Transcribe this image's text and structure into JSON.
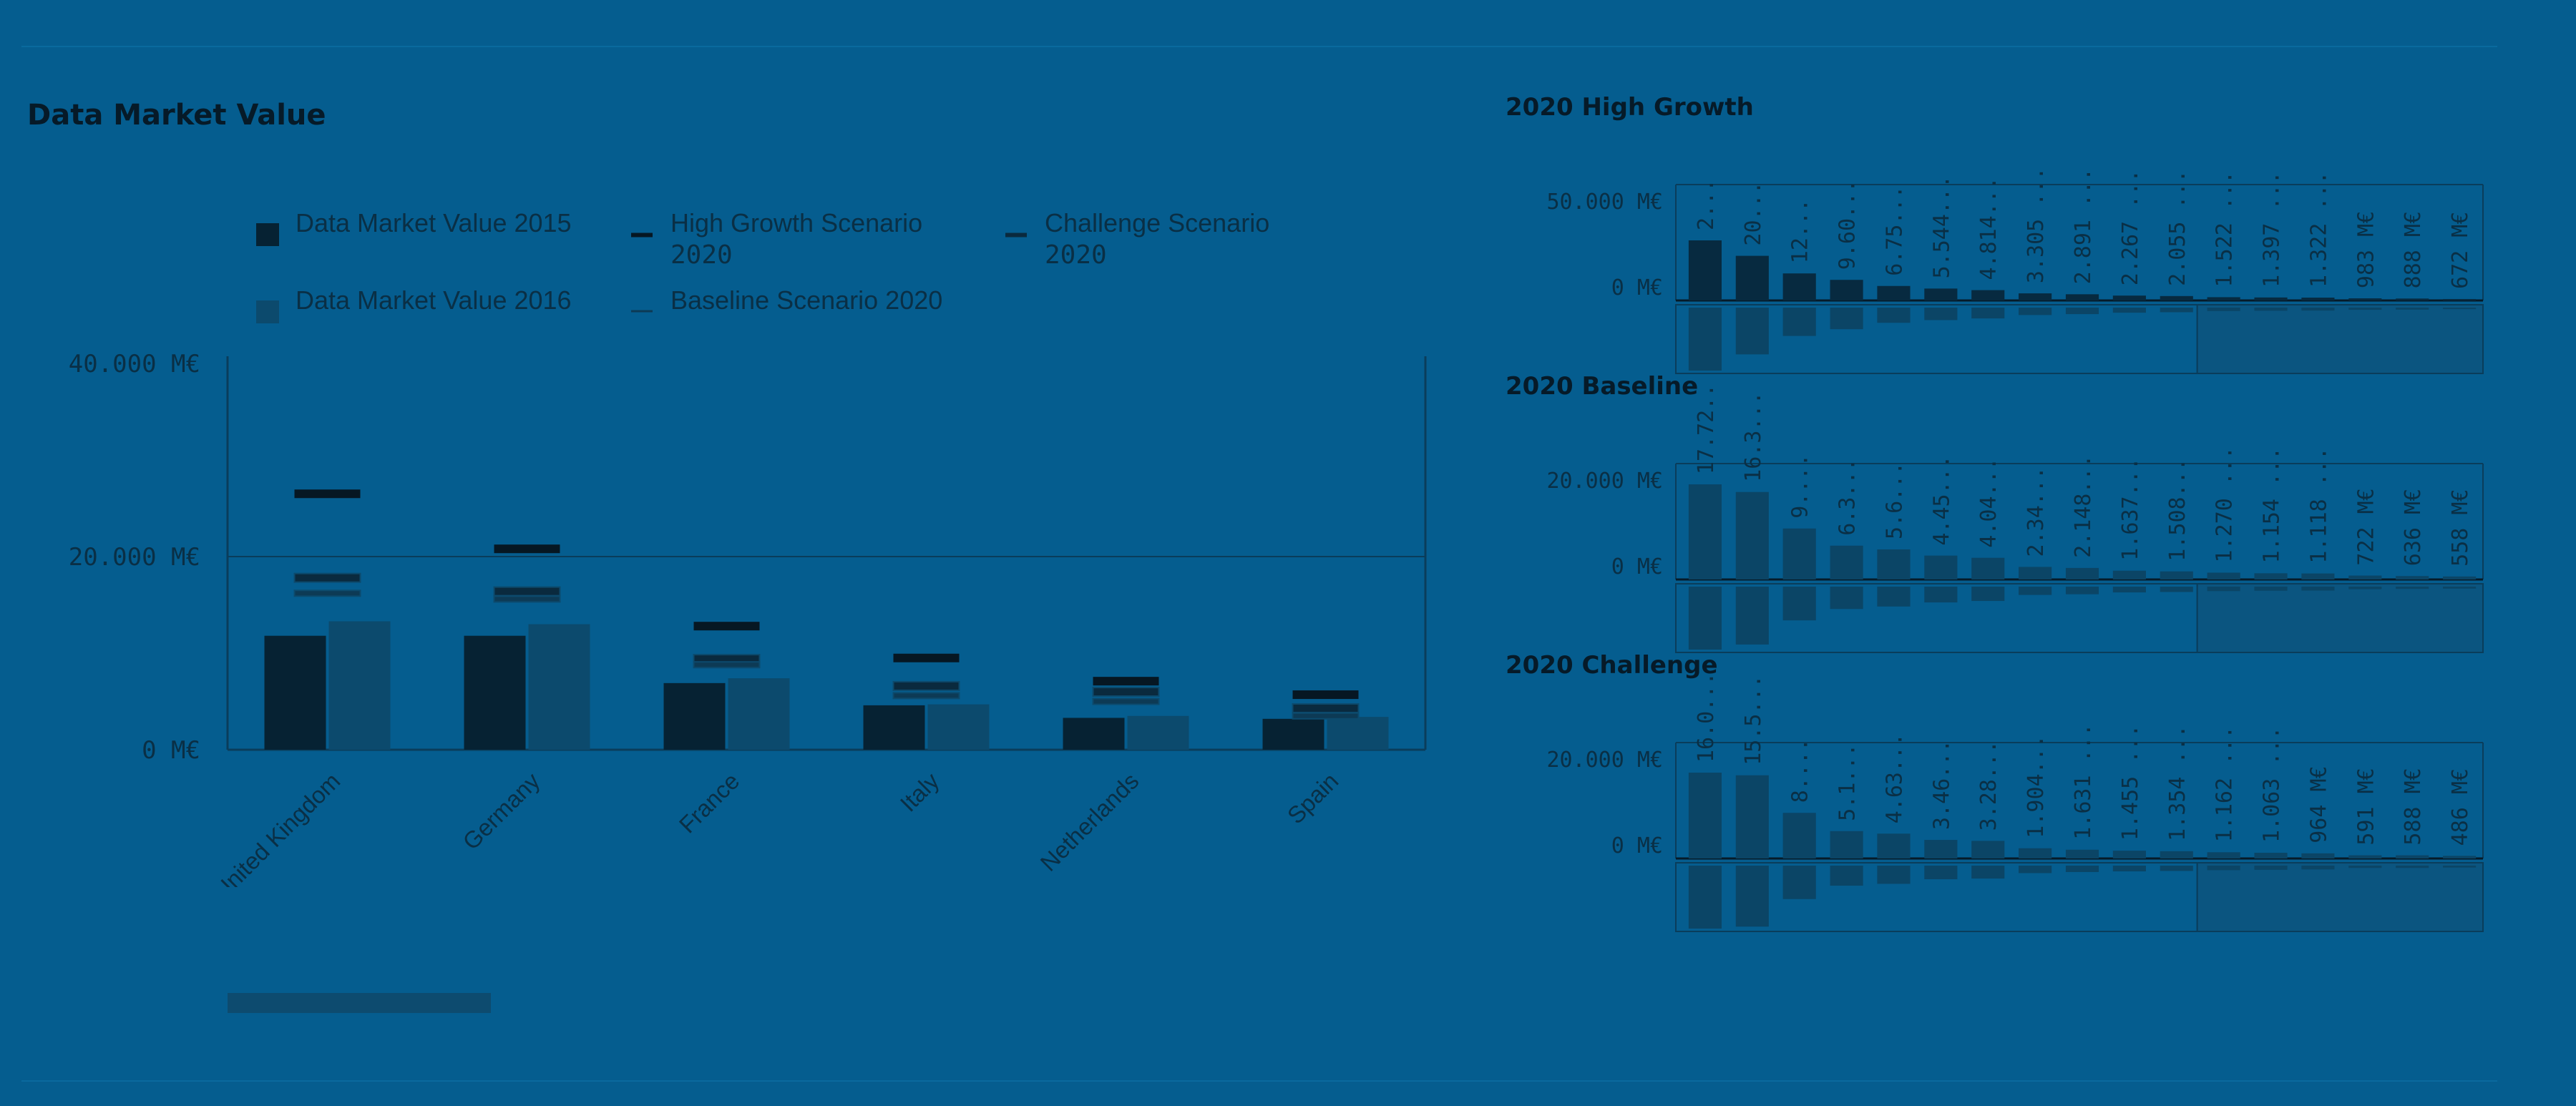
{
  "colors": {
    "background": "#055d8f",
    "ink": "#061a28",
    "axis_text": "#0a2f45",
    "value_2015": "#062233",
    "value_2016": "#0c4a6d",
    "high_growth": "#061723",
    "challenge": "#0a2a3e",
    "baseline": "#0d3a55",
    "gridline": "#0a3d5b",
    "mini_bar_dark": "#072a40",
    "mini_bar_mid": "#0b4566",
    "selection": "#0b5580"
  },
  "main": {
    "title": "Data Market Value",
    "chart_data": {
      "type": "bar",
      "title": "Data Market Value",
      "categories": [
        "United Kingdom",
        "Germany",
        "France",
        "Italy",
        "Netherlands",
        "Spain"
      ],
      "series": [
        {
          "name": "Data Market Value 2015",
          "kind": "bar",
          "values": [
            11800,
            11800,
            6900,
            4600,
            3300,
            3200
          ]
        },
        {
          "name": "Data Market Value 2016",
          "kind": "bar",
          "values": [
            13300,
            13000,
            7400,
            4700,
            3500,
            3400
          ]
        },
        {
          "name": "High Growth Scenario 2020",
          "kind": "marker",
          "values": [
            26500,
            20800,
            12800,
            9500,
            7100,
            5700
          ]
        },
        {
          "name": "Challenge Scenario 2020",
          "kind": "marker",
          "values": [
            17800,
            16400,
            9400,
            6600,
            6000,
            4300
          ]
        },
        {
          "name": "Baseline Scenario 2020",
          "kind": "marker",
          "values": [
            16200,
            15600,
            8800,
            5600,
            5000,
            3500
          ]
        }
      ],
      "ylim": [
        0,
        40000
      ],
      "yticks": [
        "0 M€",
        "20.000 M€",
        "40.000 M€"
      ],
      "xlabel": "",
      "ylabel": "",
      "grid": true,
      "legend_position": "top"
    }
  },
  "minis": [
    {
      "title": "2020 High Growth",
      "chart_data": {
        "type": "bar",
        "title": "2020 High Growth",
        "values": [
          28000,
          20800,
          12600,
          9600,
          6750,
          5544,
          4814,
          3305,
          2891,
          2267,
          2055,
          1522,
          1397,
          1322,
          983,
          888,
          672
        ],
        "labels": [
          "2...",
          "20...",
          "12...",
          "9.60...",
          "6.75...",
          "5.544...",
          "4.814...",
          "3.305 ...",
          "2.891 ...",
          "2.267 ...",
          "2.055 ...",
          "1.522 ...",
          "1.397 ...",
          "1.322 ...",
          "983 M€",
          "888 M€",
          "672 M€"
        ],
        "yticks": [
          "0 M€",
          "50.000 M€"
        ],
        "ylim": [
          0,
          50000
        ]
      }
    },
    {
      "title": "2020 Baseline",
      "chart_data": {
        "type": "bar",
        "title": "2020 Baseline",
        "values": [
          17724,
          16300,
          9500,
          6300,
          5600,
          4450,
          4040,
          2340,
          2148,
          1637,
          1508,
          1270,
          1154,
          1118,
          722,
          636,
          558
        ],
        "labels": [
          "17.72...",
          "16.3...",
          "9....",
          "6.3...",
          "5.6...",
          "4.45...",
          "4.04...",
          "2.34...",
          "2.148...",
          "1.637...",
          "1.508...",
          "1.270 ...",
          "1.154 ...",
          "1.118 ...",
          "722 M€",
          "636 M€",
          "558 M€"
        ],
        "yticks": [
          "0 M€",
          "20.000 M€"
        ],
        "ylim": [
          0,
          20000
        ]
      }
    },
    {
      "title": "2020 Challenge",
      "chart_data": {
        "type": "bar",
        "title": "2020 Challenge",
        "values": [
          16000,
          15500,
          8500,
          5100,
          4630,
          3460,
          3280,
          1904,
          1631,
          1455,
          1354,
          1162,
          1063,
          964,
          591,
          588,
          486
        ],
        "labels": [
          "16.0...",
          "15.5...",
          "8....",
          "5.1...",
          "4.63...",
          "3.46...",
          "3.28...",
          "1.904...",
          "1.631 ...",
          "1.455 ...",
          "1.354 ...",
          "1.162 ...",
          "1.063 ...",
          "964 M€",
          "591 M€",
          "588 M€",
          "486 M€"
        ],
        "yticks": [
          "0 M€",
          "20.000 M€"
        ],
        "ylim": [
          0,
          20000
        ]
      }
    }
  ]
}
